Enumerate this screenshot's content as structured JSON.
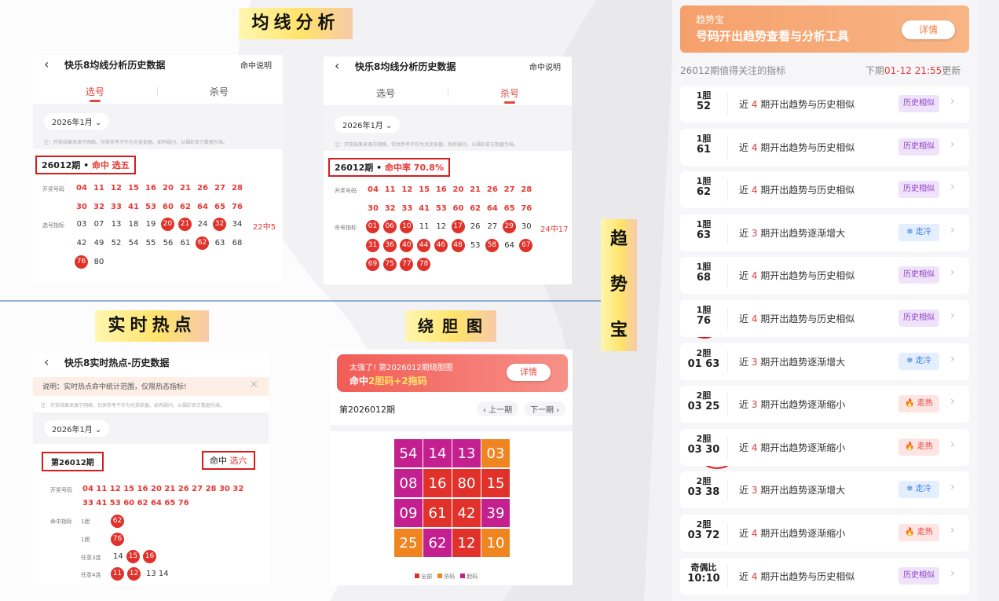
{
  "labels": {
    "junxian": "均线分析",
    "shishi": "实时热点",
    "raodan": "绕 胆 图",
    "qushi": [
      "趋",
      "势",
      "宝"
    ]
  },
  "p1": {
    "title": "快乐8均线分析历史数据",
    "link": "命中说明",
    "tab1": "选号",
    "tab2": "杀号",
    "date": "2026年1月 ⌄",
    "note": "注：开奖结果来源于网络，仅供参考不作为兑奖依据。如有疑问，以福彩官方数据为准。",
    "box_pre": "26012期 • ",
    "box_hit": "命中 选五",
    "lbl_draw": "开奖号码",
    "lbl_pick": "选号指标",
    "draw": [
      "04",
      "11",
      "12",
      "15",
      "16",
      "20",
      "21",
      "26",
      "27",
      "28",
      "30",
      "32",
      "33",
      "41",
      "53",
      "60",
      "62",
      "64",
      "65",
      "76"
    ],
    "picks": [
      "03",
      "07",
      "13",
      "18",
      "19",
      "20",
      "21",
      "24",
      "32",
      "34",
      "42",
      "49",
      "52",
      "54",
      "55",
      "56",
      "61",
      "62",
      "63",
      "68",
      "76",
      "80"
    ],
    "ratio": "22中5"
  },
  "p2": {
    "title": "快乐8均线分析历史数据",
    "link": "命中说明",
    "tab1": "选号",
    "tab2": "杀号",
    "date": "2026年1月 ⌄",
    "note": "注：开奖结果来源于网络，仅供参考不作为兑奖依据。如有疑问，以福彩官方数据为准。",
    "box_pre": "26012期 • ",
    "box_hit": "命中率 70.8%",
    "lbl_draw": "开奖号码",
    "lbl_kill": "杀号指标",
    "draw": [
      "04",
      "11",
      "12",
      "15",
      "16",
      "20",
      "21",
      "26",
      "27",
      "28",
      "30",
      "32",
      "33",
      "41",
      "53",
      "60",
      "62",
      "64",
      "65",
      "76"
    ],
    "kills": [
      "01",
      "06",
      "10",
      "11",
      "12",
      "17",
      "26",
      "27",
      "29",
      "30",
      "31",
      "36",
      "40",
      "44",
      "46",
      "48",
      "53",
      "58",
      "64",
      "67",
      "69",
      "75",
      "77",
      "78"
    ],
    "ratio": "24中17"
  },
  "p3": {
    "title": "快乐8实时热点-历史数据",
    "tip": "说明：实时热点命中统计范围，仅限热态指标!",
    "note": "注：开奖结果来源于网络，仅供参考不作为兑奖依据。如有疑问，以福彩官方数据为准。",
    "date": "2026年1月 ⌄",
    "period": "第26012期",
    "hit_pre": "命中 ",
    "hit_val": "选六",
    "lbl_draw": "开奖号码",
    "draw1": "04 11 12 15 16 20 21 26 27 28 30 32",
    "draw2": "33 41 53 60 62 64 65 76",
    "lbl_ind": "命中指标",
    "r1": "1胆",
    "r2": "1胆",
    "r3": "任意3连",
    "r4": "任意4连",
    "r1b": [
      "62"
    ],
    "r2b": [
      "76"
    ],
    "r3n": "14",
    "r3b": [
      "15",
      "16"
    ],
    "r4b": [
      "11",
      "12"
    ],
    "r4n": "13  14"
  },
  "p4": {
    "banner1": "太强了! 第2026012期绕胆图",
    "banner2_pre": "命中",
    "banner2_hit": "2胆码+2拖码",
    "btn": "详情",
    "period": "第2026012期",
    "prev": "‹ 上一期",
    "next": "下一期 ›",
    "grid": [
      "54",
      "14",
      "13",
      "03",
      "08",
      "16",
      "80",
      "15",
      "09",
      "61",
      "42",
      "39",
      "25",
      "62",
      "12",
      "10"
    ],
    "legend": [
      "全部",
      "杀码",
      "胆码"
    ]
  },
  "p5": {
    "banner_small": "趋势宝",
    "banner_big": "号码开出趋势查看与分析工具",
    "btn": "详情",
    "sub_left": "26012期值得关注的指标",
    "sub_r1": "下期",
    "sub_r2": "01-12 21:55",
    "sub_r3": "更新",
    "rows": [
      {
        "t1": "1胆",
        "t2": "52",
        "pre": "近 ",
        "n": "4",
        "post": " 期开出趋势与历史相似",
        "badge": "历史相似"
      },
      {
        "t1": "1胆",
        "t2": "61",
        "pre": "近 ",
        "n": "4",
        "post": " 期开出趋势与历史相似",
        "badge": "历史相似"
      },
      {
        "t1": "1胆",
        "t2": "62",
        "pre": "近 ",
        "n": "4",
        "post": " 期开出趋势与历史相似",
        "badge": "历史相似"
      },
      {
        "t1": "1胆",
        "t2": "63",
        "pre": "近 ",
        "n": "3",
        "post": " 期开出趋势逐渐增大",
        "badge": "❄ 走冷"
      },
      {
        "t1": "1胆",
        "t2": "68",
        "pre": "近 ",
        "n": "4",
        "post": " 期开出趋势与历史相似",
        "badge": "历史相似"
      },
      {
        "t1": "1胆",
        "t2": "76",
        "pre": "近 ",
        "n": "4",
        "post": " 期开出趋势与历史相似",
        "badge": "历史相似"
      },
      {
        "t1": "2胆",
        "t2": "01 63",
        "pre": "近 ",
        "n": "3",
        "post": " 期开出趋势逐渐增大",
        "badge": "❄ 走冷"
      },
      {
        "t1": "2胆",
        "t2": "03 25",
        "pre": "近 ",
        "n": "3",
        "post": " 期开出趋势逐渐缩小",
        "badge": "🔥 走热"
      },
      {
        "t1": "2胆",
        "t2": "03 30",
        "pre": "近 ",
        "n": "4",
        "post": " 期开出趋势逐渐缩小",
        "badge": "🔥 走热"
      },
      {
        "t1": "2胆",
        "t2": "03 38",
        "pre": "近 ",
        "n": "3",
        "post": " 期开出趋势逐渐增大",
        "badge": "❄ 走冷"
      },
      {
        "t1": "2胆",
        "t2": "03 72",
        "pre": "近 ",
        "n": "4",
        "post": " 期开出趋势逐渐缩小",
        "badge": "🔥 走热"
      },
      {
        "t1": "奇偶比",
        "t2": "10:10",
        "pre": "近 ",
        "n": "4",
        "post": " 期开出趋势与历史相似",
        "badge": "历史相似"
      }
    ]
  },
  "colors": {
    "red": "#e0312a",
    "magenta": "#c41f8f",
    "orange": "#ef8521",
    "banner": "#f7a36d"
  }
}
